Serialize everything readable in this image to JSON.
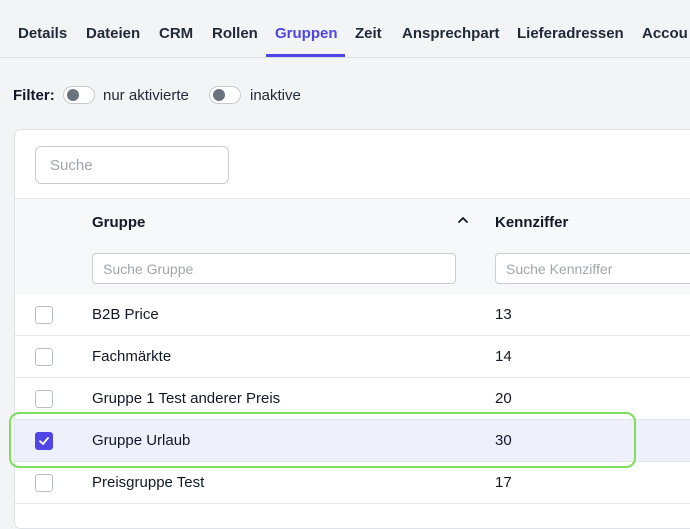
{
  "tabs": [
    {
      "label": "Details"
    },
    {
      "label": "Dateien"
    },
    {
      "label": "CRM"
    },
    {
      "label": "Rollen"
    },
    {
      "label": "Gruppen",
      "active": true
    },
    {
      "label": "Zeit"
    },
    {
      "label": "Ansprechpart"
    },
    {
      "label": "Lieferadressen"
    },
    {
      "label": "Accou"
    }
  ],
  "filter": {
    "label": "Filter",
    "colon": ":",
    "toggles": [
      {
        "label": "nur aktivierte",
        "on": false
      },
      {
        "label": "inaktive",
        "on": false
      }
    ]
  },
  "search": {
    "placeholder": "Suche"
  },
  "table": {
    "columns": [
      {
        "label": "Gruppe",
        "filter_placeholder": "Suche Gruppe",
        "sort": "ascending"
      },
      {
        "label": "Kennziffer",
        "filter_placeholder": "Suche Kennziffer"
      }
    ],
    "rows": [
      {
        "gruppe": "B2B Price",
        "kennziffer": "13",
        "checked": false
      },
      {
        "gruppe": "Fachmärkte",
        "kennziffer": "14",
        "checked": false
      },
      {
        "gruppe": "Gruppe 1 Test anderer Preis",
        "kennziffer": "20",
        "checked": false
      },
      {
        "gruppe": "Gruppe Urlaub",
        "kennziffer": "30",
        "checked": true
      },
      {
        "gruppe": "Preisgruppe Test",
        "kennziffer": "17",
        "checked": false
      }
    ]
  },
  "colors": {
    "accent": "#4f46e5",
    "highlight": "#7ee05a"
  },
  "icons": {
    "sort": "chevron-up-icon",
    "check": "check-icon"
  }
}
